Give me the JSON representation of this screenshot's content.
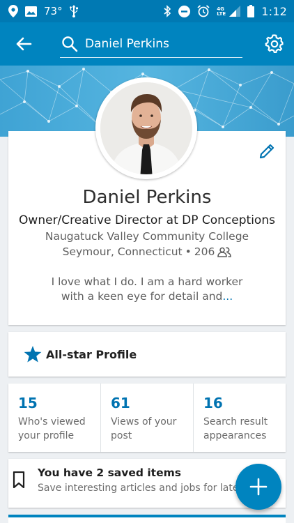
{
  "status_bar": {
    "temperature": "73°",
    "time": "1:12",
    "network": "4G LTE",
    "icons": [
      "location-icon",
      "image-icon",
      "usb-icon",
      "bluetooth-icon",
      "do-not-disturb-icon",
      "alarm-icon",
      "signal-icon",
      "battery-icon"
    ]
  },
  "app_bar": {
    "search_value": "Daniel Perkins",
    "icons": [
      "back-arrow-icon",
      "search-icon",
      "gear-icon"
    ]
  },
  "profile": {
    "name": "Daniel Perkins",
    "headline": "Owner/Creative Director at DP Conceptions",
    "school": "Naugatuck Valley Community College",
    "location": "Seymour, Connecticut",
    "separator": "•",
    "connections": "206",
    "summary_line1": "I love what I do. I am a hard worker",
    "summary_line2": "with a keen eye for detail and",
    "summary_more": "..."
  },
  "allstar": {
    "label": "All-star Profile"
  },
  "stats": [
    {
      "number": "15",
      "line1": "Who's viewed",
      "line2": "your profile"
    },
    {
      "number": "61",
      "line1": "Views of your",
      "line2": "post"
    },
    {
      "number": "16",
      "line1": "Search result",
      "line2": "appearances"
    }
  ],
  "saved": {
    "title": "You have 2 saved items",
    "subtitle": "Save interesting articles and jobs for later"
  },
  "colors": {
    "primary": "#0084bf",
    "status_bar": "#0079b3",
    "link": "#0073b1",
    "banner": "#4aaedc",
    "background": "#edf0f3"
  }
}
